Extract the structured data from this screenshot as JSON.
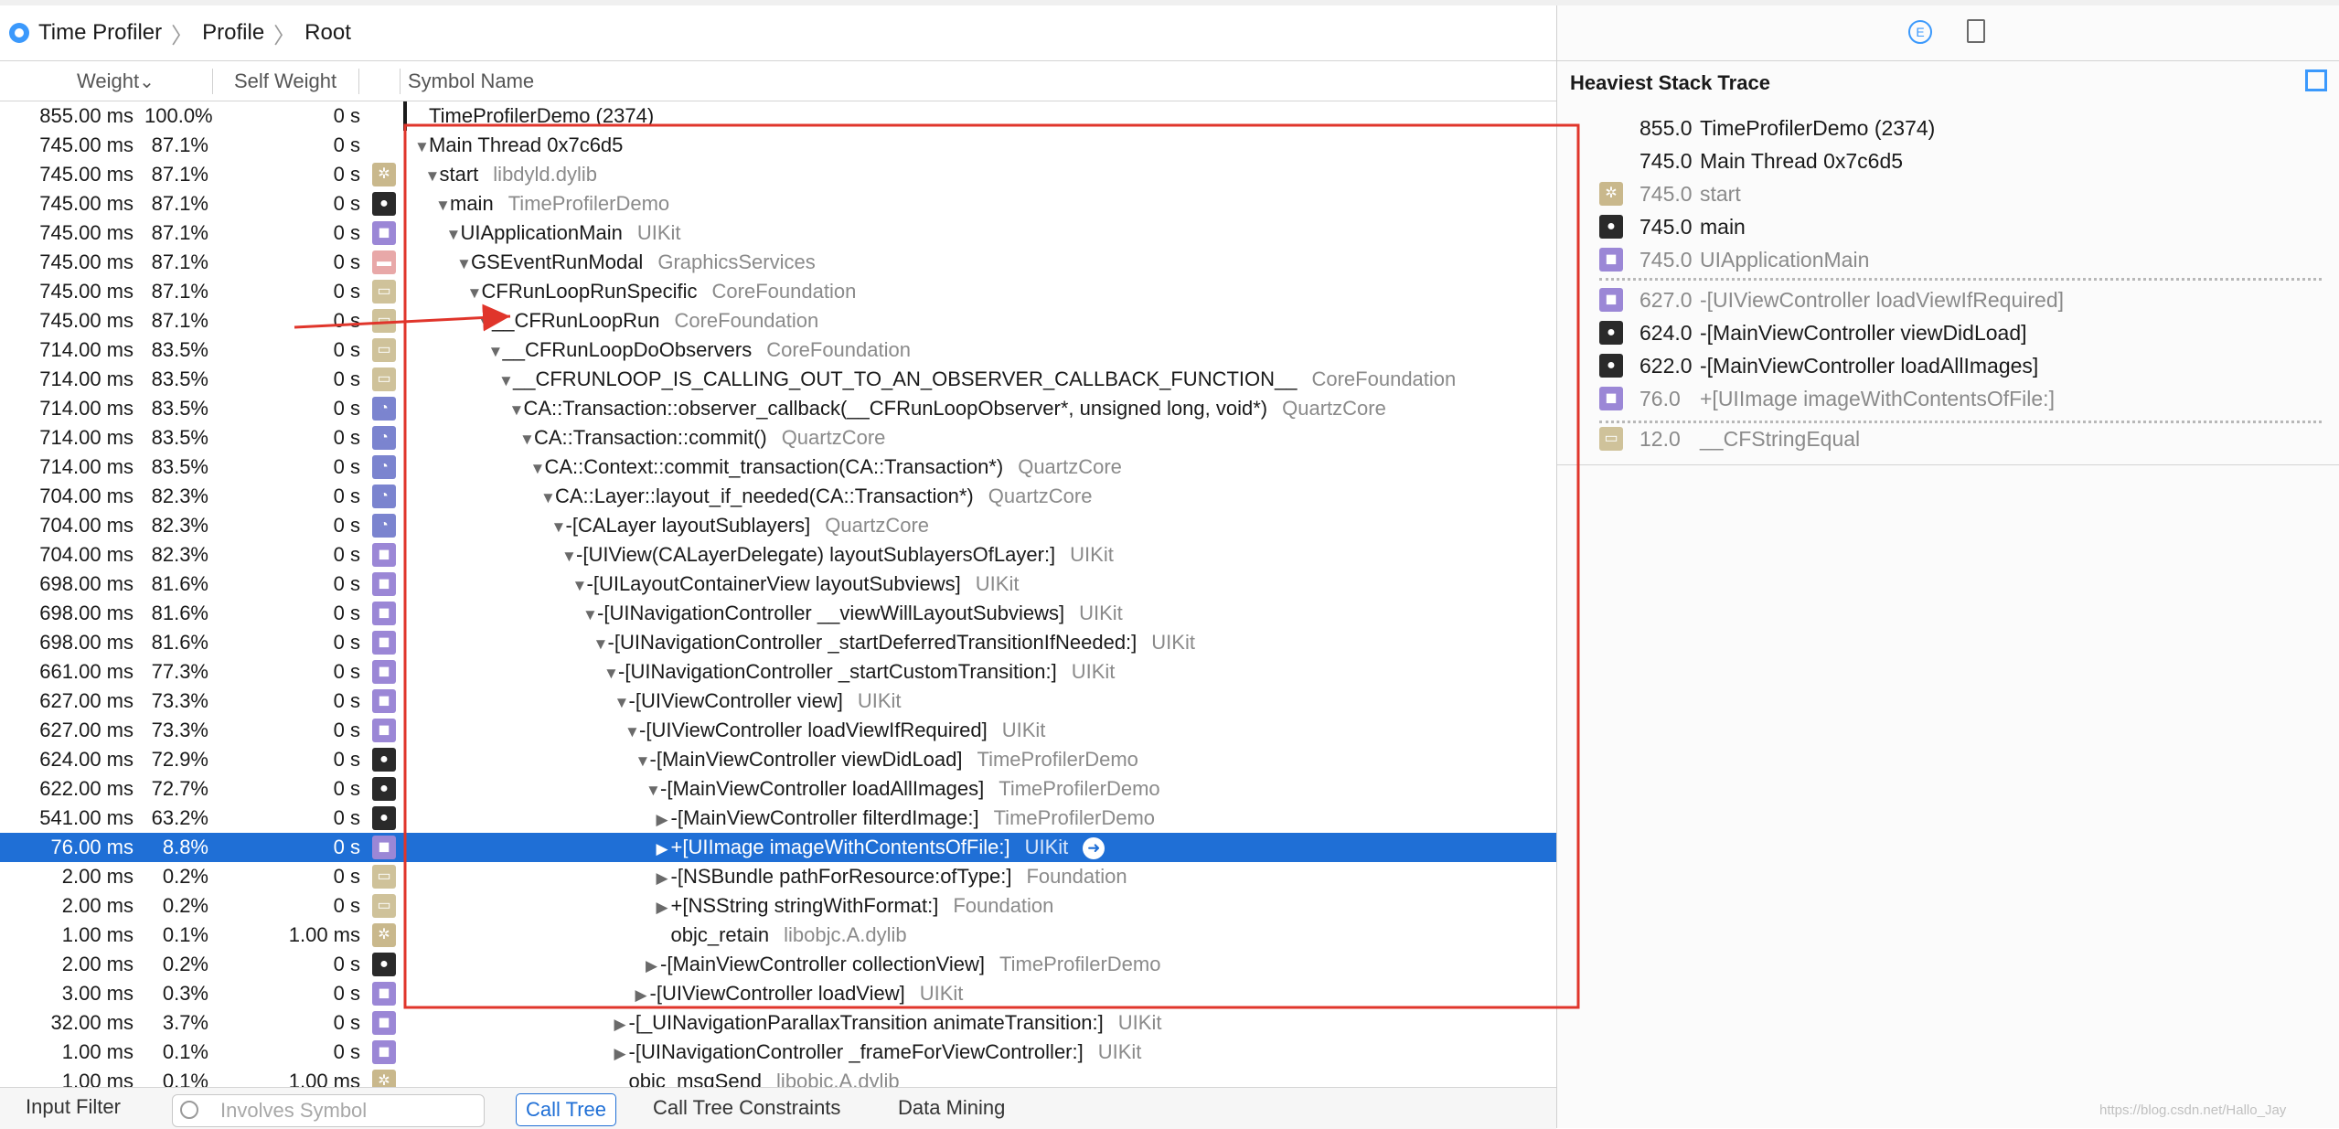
{
  "breadcrumb": {
    "app": "Time Profiler",
    "profile": "Profile",
    "root": "Root",
    "sep": "〉"
  },
  "columns": {
    "weight": "Weight",
    "self_weight": "Self Weight",
    "symbol": "Symbol Name"
  },
  "sort_indicator": "⌄",
  "rows": [
    {
      "weight": "855.00 ms",
      "pct": "100.0%",
      "self": "0 s",
      "icon": "",
      "indent": 0,
      "tri": "",
      "symbol": "TimeProfilerDemo (2374)",
      "lib": ""
    },
    {
      "weight": "745.00 ms",
      "pct": "87.1%",
      "self": "0 s",
      "icon": "",
      "indent": 0,
      "tri": "▼",
      "symbol": "Main Thread  0x7c6d5",
      "lib": ""
    },
    {
      "weight": "745.00 ms",
      "pct": "87.1%",
      "self": "0 s",
      "icon": "gear",
      "indent": 1,
      "tri": "▼",
      "symbol": "start",
      "lib": "libdyld.dylib"
    },
    {
      "weight": "745.00 ms",
      "pct": "87.1%",
      "self": "0 s",
      "icon": "person",
      "indent": 2,
      "tri": "▼",
      "symbol": "main",
      "lib": "TimeProfilerDemo"
    },
    {
      "weight": "745.00 ms",
      "pct": "87.1%",
      "self": "0 s",
      "icon": "mug",
      "indent": 3,
      "tri": "▼",
      "symbol": "UIApplicationMain",
      "lib": "UIKit"
    },
    {
      "weight": "745.00 ms",
      "pct": "87.1%",
      "self": "0 s",
      "icon": "case",
      "indent": 4,
      "tri": "▼",
      "symbol": "GSEventRunModal",
      "lib": "GraphicsServices"
    },
    {
      "weight": "745.00 ms",
      "pct": "87.1%",
      "self": "0 s",
      "icon": "doc",
      "indent": 5,
      "tri": "▼",
      "symbol": "CFRunLoopRunSpecific",
      "lib": "CoreFoundation"
    },
    {
      "weight": "745.00 ms",
      "pct": "87.1%",
      "self": "0 s",
      "icon": "doc",
      "indent": 6,
      "tri": "▼",
      "symbol": "__CFRunLoopRun",
      "lib": "CoreFoundation"
    },
    {
      "weight": "714.00 ms",
      "pct": "83.5%",
      "self": "0 s",
      "icon": "doc",
      "indent": 7,
      "tri": "▼",
      "symbol": "__CFRunLoopDoObservers",
      "lib": "CoreFoundation"
    },
    {
      "weight": "714.00 ms",
      "pct": "83.5%",
      "self": "0 s",
      "icon": "doc",
      "indent": 8,
      "tri": "▼",
      "symbol": "__CFRUNLOOP_IS_CALLING_OUT_TO_AN_OBSERVER_CALLBACK_FUNCTION__",
      "lib": "CoreFoundation"
    },
    {
      "weight": "714.00 ms",
      "pct": "83.5%",
      "self": "0 s",
      "icon": "pie",
      "indent": 9,
      "tri": "▼",
      "symbol": "CA::Transaction::observer_callback(__CFRunLoopObserver*, unsigned long, void*)",
      "lib": "QuartzCore"
    },
    {
      "weight": "714.00 ms",
      "pct": "83.5%",
      "self": "0 s",
      "icon": "pie",
      "indent": 10,
      "tri": "▼",
      "symbol": "CA::Transaction::commit()",
      "lib": "QuartzCore"
    },
    {
      "weight": "714.00 ms",
      "pct": "83.5%",
      "self": "0 s",
      "icon": "pie",
      "indent": 11,
      "tri": "▼",
      "symbol": "CA::Context::commit_transaction(CA::Transaction*)",
      "lib": "QuartzCore"
    },
    {
      "weight": "704.00 ms",
      "pct": "82.3%",
      "self": "0 s",
      "icon": "pie",
      "indent": 12,
      "tri": "▼",
      "symbol": "CA::Layer::layout_if_needed(CA::Transaction*)",
      "lib": "QuartzCore"
    },
    {
      "weight": "704.00 ms",
      "pct": "82.3%",
      "self": "0 s",
      "icon": "pie",
      "indent": 13,
      "tri": "▼",
      "symbol": "-[CALayer layoutSublayers]",
      "lib": "QuartzCore"
    },
    {
      "weight": "704.00 ms",
      "pct": "82.3%",
      "self": "0 s",
      "icon": "mug",
      "indent": 14,
      "tri": "▼",
      "symbol": "-[UIView(CALayerDelegate) layoutSublayersOfLayer:]",
      "lib": "UIKit"
    },
    {
      "weight": "698.00 ms",
      "pct": "81.6%",
      "self": "0 s",
      "icon": "mug",
      "indent": 15,
      "tri": "▼",
      "symbol": "-[UILayoutContainerView layoutSubviews]",
      "lib": "UIKit"
    },
    {
      "weight": "698.00 ms",
      "pct": "81.6%",
      "self": "0 s",
      "icon": "mug",
      "indent": 16,
      "tri": "▼",
      "symbol": "-[UINavigationController __viewWillLayoutSubviews]",
      "lib": "UIKit"
    },
    {
      "weight": "698.00 ms",
      "pct": "81.6%",
      "self": "0 s",
      "icon": "mug",
      "indent": 17,
      "tri": "▼",
      "symbol": "-[UINavigationController _startDeferredTransitionIfNeeded:]",
      "lib": "UIKit"
    },
    {
      "weight": "661.00 ms",
      "pct": "77.3%",
      "self": "0 s",
      "icon": "mug",
      "indent": 18,
      "tri": "▼",
      "symbol": "-[UINavigationController _startCustomTransition:]",
      "lib": "UIKit"
    },
    {
      "weight": "627.00 ms",
      "pct": "73.3%",
      "self": "0 s",
      "icon": "mug",
      "indent": 19,
      "tri": "▼",
      "symbol": "-[UIViewController view]",
      "lib": "UIKit"
    },
    {
      "weight": "627.00 ms",
      "pct": "73.3%",
      "self": "0 s",
      "icon": "mug",
      "indent": 20,
      "tri": "▼",
      "symbol": "-[UIViewController loadViewIfRequired]",
      "lib": "UIKit"
    },
    {
      "weight": "624.00 ms",
      "pct": "72.9%",
      "self": "0 s",
      "icon": "person",
      "indent": 21,
      "tri": "▼",
      "symbol": "-[MainViewController viewDidLoad]",
      "lib": "TimeProfilerDemo"
    },
    {
      "weight": "622.00 ms",
      "pct": "72.7%",
      "self": "0 s",
      "icon": "person",
      "indent": 22,
      "tri": "▼",
      "symbol": "-[MainViewController loadAllImages]",
      "lib": "TimeProfilerDemo"
    },
    {
      "weight": "541.00 ms",
      "pct": "63.2%",
      "self": "0 s",
      "icon": "person",
      "indent": 23,
      "tri": "▶",
      "symbol": "-[MainViewController filterdImage:]",
      "lib": "TimeProfilerDemo"
    },
    {
      "weight": "76.00 ms",
      "pct": "8.8%",
      "self": "0 s",
      "icon": "mug",
      "indent": 23,
      "tri": "▶",
      "symbol": "+[UIImage imageWithContentsOfFile:]",
      "lib": "UIKit",
      "selected": true,
      "go": "➜"
    },
    {
      "weight": "2.00 ms",
      "pct": "0.2%",
      "self": "0 s",
      "icon": "doc",
      "indent": 23,
      "tri": "▶",
      "symbol": "-[NSBundle pathForResource:ofType:]",
      "lib": "Foundation"
    },
    {
      "weight": "2.00 ms",
      "pct": "0.2%",
      "self": "0 s",
      "icon": "doc",
      "indent": 23,
      "tri": "▶",
      "symbol": "+[NSString stringWithFormat:]",
      "lib": "Foundation"
    },
    {
      "weight": "1.00 ms",
      "pct": "0.1%",
      "self": "1.00 ms",
      "icon": "gear",
      "indent": 23,
      "tri": "",
      "symbol": "objc_retain",
      "lib": "libobjc.A.dylib"
    },
    {
      "weight": "2.00 ms",
      "pct": "0.2%",
      "self": "0 s",
      "icon": "person",
      "indent": 22,
      "tri": "▶",
      "symbol": "-[MainViewController collectionView]",
      "lib": "TimeProfilerDemo"
    },
    {
      "weight": "3.00 ms",
      "pct": "0.3%",
      "self": "0 s",
      "icon": "mug",
      "indent": 21,
      "tri": "▶",
      "symbol": "-[UIViewController loadView]",
      "lib": "UIKit"
    },
    {
      "weight": "32.00 ms",
      "pct": "3.7%",
      "self": "0 s",
      "icon": "mug",
      "indent": 19,
      "tri": "▶",
      "symbol": "-[_UINavigationParallaxTransition animateTransition:]",
      "lib": "UIKit"
    },
    {
      "weight": "1.00 ms",
      "pct": "0.1%",
      "self": "0 s",
      "icon": "mug",
      "indent": 19,
      "tri": "▶",
      "symbol": "-[UINavigationController _frameForViewController:]",
      "lib": "UIKit"
    },
    {
      "weight": "1.00 ms",
      "pct": "0.1%",
      "self": "1.00 ms",
      "icon": "gear",
      "indent": 19,
      "tri": "",
      "symbol": "objc_msgSend",
      "lib": "libobjc.A.dylib"
    }
  ],
  "bottom": {
    "input_filter": "Input Filter",
    "search_placeholder": "Involves Symbol",
    "call_tree": "Call Tree",
    "constraints": "Call Tree Constraints",
    "data_mining": "Data Mining"
  },
  "right": {
    "title": "Heaviest Stack Trace",
    "icon_e": "E",
    "items": [
      {
        "value": "855.0",
        "symbol": "TimeProfilerDemo (2374)",
        "icon": "",
        "dim": false
      },
      {
        "value": "745.0",
        "symbol": "Main Thread  0x7c6d5",
        "icon": "",
        "dim": false
      },
      {
        "value": "745.0",
        "symbol": "start",
        "icon": "gear",
        "dim": true
      },
      {
        "value": "745.0",
        "symbol": "main",
        "icon": "person",
        "dim": false
      },
      {
        "value": "745.0",
        "symbol": "UIApplicationMain",
        "icon": "mug",
        "dim": true
      },
      {
        "value": "627.0",
        "symbol": "-[UIViewController loadViewIfRequired]",
        "icon": "mug",
        "dim": true
      },
      {
        "value": "624.0",
        "symbol": "-[MainViewController viewDidLoad]",
        "icon": "person",
        "dim": false
      },
      {
        "value": "622.0",
        "symbol": "-[MainViewController loadAllImages]",
        "icon": "person",
        "dim": false
      },
      {
        "value": "76.0",
        "symbol": "+[UIImage imageWithContentsOfFile:]",
        "icon": "mug",
        "dim": true
      },
      {
        "value": "12.0",
        "symbol": "__CFStringEqual",
        "icon": "doc",
        "dim": true
      }
    ]
  },
  "watermark": "https://blog.csdn.net/Hallo_Jay",
  "colors": {
    "accent": "#1f6fd6",
    "annotation": "#e0352b",
    "icon_blue": "#3b99fc"
  }
}
